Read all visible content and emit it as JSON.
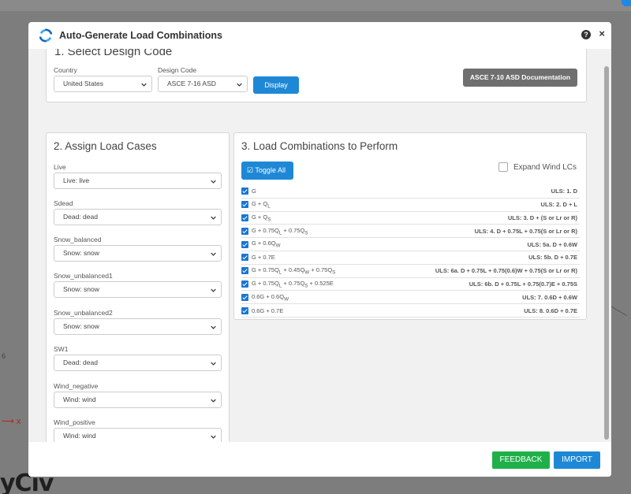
{
  "background": {
    "brand_fragment": "yCiv",
    "axis_label": "x",
    "side_number": "6"
  },
  "modal": {
    "title": "Auto-Generate Load Combinations",
    "help_glyph": "?",
    "close_glyph": "×"
  },
  "design_code": {
    "title": "1. Select Design Code",
    "country_label": "Country",
    "country_value": "United States",
    "design_code_label": "Design Code",
    "design_code_value": "ASCE 7-16 ASD",
    "display_button": "Display",
    "doc_button": "ASCE 7-10 ASD Documentation"
  },
  "assign": {
    "title": "2. Assign Load Cases",
    "cases": [
      {
        "label": "Live",
        "value": "Live: live"
      },
      {
        "label": "Sdead",
        "value": "Dead: dead"
      },
      {
        "label": "Snow_balanced",
        "value": "Snow: snow"
      },
      {
        "label": "Snow_unbalanced1",
        "value": "Snow: snow"
      },
      {
        "label": "Snow_unbalanced2",
        "value": "Snow: snow"
      },
      {
        "label": "SW1",
        "value": "Dead: dead"
      },
      {
        "label": "Wind_negative",
        "value": "Wind: wind"
      },
      {
        "label": "Wind_positive",
        "value": "Wind: wind"
      }
    ]
  },
  "combos": {
    "title": "3. Load Combinations to Perform",
    "toggle_all": "Toggle All",
    "expand_wind": "Expand Wind LCs",
    "rows": [
      {
        "formula": "G",
        "uls": "ULS: 1. D",
        "checked": true
      },
      {
        "formula": "G + QL",
        "uls": "ULS: 2. D + L",
        "checked": true
      },
      {
        "formula": "G + QS",
        "uls": "ULS: 3. D + (S or Lr or R)",
        "checked": true
      },
      {
        "formula": "G + 0.75QL + 0.75QS",
        "uls": "ULS: 4. D + 0.75L + 0.75(S or Lr or R)",
        "checked": true
      },
      {
        "formula": "G + 0.6QW",
        "uls": "ULS: 5a. D + 0.6W",
        "checked": true
      },
      {
        "formula": "G + 0.7E",
        "uls": "ULS: 5b. D + 0.7E",
        "checked": true
      },
      {
        "formula": "G + 0.75QL + 0.45QW + 0.75QS",
        "uls": "ULS: 6a. D + 0.75L + 0.75(0.6)W + 0.75(S or Lr or R)",
        "checked": true
      },
      {
        "formula": "G + 0.75QL + 0.75QS + 0.525E",
        "uls": "ULS: 6b. D + 0.75L + 0.75(0.7)E + 0.75S",
        "checked": true
      },
      {
        "formula": "0.6G + 0.6QW",
        "uls": "ULS: 7. 0.6D + 0.6W",
        "checked": true
      },
      {
        "formula": "0.6G + 0.7E",
        "uls": "ULS: 8. 0.6D + 0.7E",
        "checked": true
      }
    ]
  },
  "footer": {
    "feedback": "FEEDBACK",
    "import": "IMPORT"
  },
  "colors": {
    "primary": "#1e88d6",
    "success": "#1fb04a",
    "neutral_button": "#6f6f6f"
  }
}
